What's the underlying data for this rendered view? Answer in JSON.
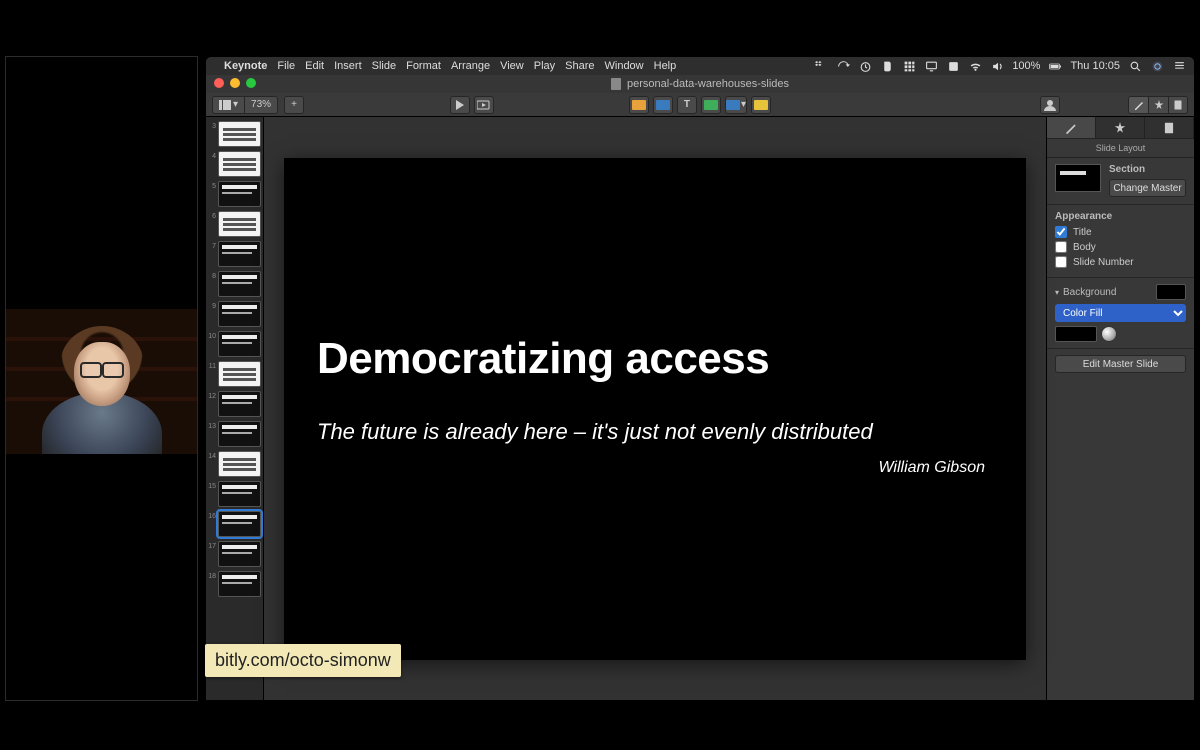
{
  "menubar": {
    "app": "Keynote",
    "items": [
      "File",
      "Edit",
      "Insert",
      "Slide",
      "Format",
      "Arrange",
      "View",
      "Play",
      "Share",
      "Window",
      "Help"
    ],
    "battery": "100%",
    "clock": "Thu 10:05"
  },
  "window": {
    "title": "personal-data-warehouses-slides"
  },
  "toolbar": {
    "zoom": "73%",
    "view_label": "View",
    "add_slide": "+",
    "play": "▶",
    "present": "▭",
    "center_buttons": [
      "Table",
      "Chart",
      "Text",
      "Shape",
      "Media",
      "Comment"
    ],
    "collab": "Collaborate"
  },
  "navigator": {
    "start_index": 3,
    "count": 16,
    "selected_index": 16
  },
  "slide": {
    "title": "Democratizing access",
    "quote": "The future is already here – it's just not evenly distributed",
    "author": "William Gibson"
  },
  "inspector": {
    "subhead": "Slide Layout",
    "section_label": "Section",
    "change_master": "Change Master",
    "appearance_label": "Appearance",
    "chk_title": "Title",
    "chk_body": "Body",
    "chk_slidenum": "Slide Number",
    "background_label": "Background",
    "fill_mode": "Color Fill",
    "edit_master": "Edit Master Slide",
    "checked": {
      "title": true,
      "body": false,
      "slidenum": false
    }
  },
  "overlay_url": "bitly.com/octo-simonw"
}
